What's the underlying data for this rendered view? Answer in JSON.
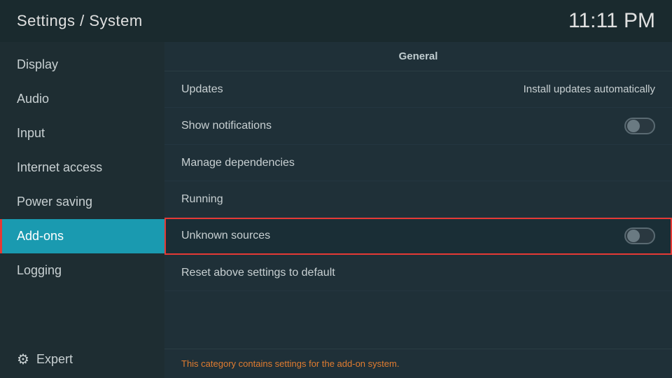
{
  "header": {
    "title": "Settings / System",
    "time": "11:11 PM"
  },
  "sidebar": {
    "items": [
      {
        "id": "display",
        "label": "Display",
        "active": false
      },
      {
        "id": "audio",
        "label": "Audio",
        "active": false
      },
      {
        "id": "input",
        "label": "Input",
        "active": false
      },
      {
        "id": "internet-access",
        "label": "Internet access",
        "active": false
      },
      {
        "id": "power-saving",
        "label": "Power saving",
        "active": false
      },
      {
        "id": "add-ons",
        "label": "Add-ons",
        "active": true
      },
      {
        "id": "logging",
        "label": "Logging",
        "active": false
      }
    ],
    "footer": {
      "label": "Expert",
      "icon": "gear"
    }
  },
  "content": {
    "section_label": "General",
    "rows": [
      {
        "id": "updates",
        "label": "Updates",
        "value": "Install updates automatically",
        "toggle": null,
        "highlighted": false
      },
      {
        "id": "show-notifications",
        "label": "Show notifications",
        "value": null,
        "toggle": "off",
        "highlighted": false
      },
      {
        "id": "manage-dependencies",
        "label": "Manage dependencies",
        "value": null,
        "toggle": null,
        "highlighted": false
      },
      {
        "id": "running",
        "label": "Running",
        "value": null,
        "toggle": null,
        "highlighted": false
      },
      {
        "id": "unknown-sources",
        "label": "Unknown sources",
        "value": null,
        "toggle": "off",
        "highlighted": true
      },
      {
        "id": "reset-above",
        "label": "Reset above settings to default",
        "value": null,
        "toggle": null,
        "highlighted": false
      }
    ],
    "footer_text": "This category contains settings for the add-on system."
  }
}
